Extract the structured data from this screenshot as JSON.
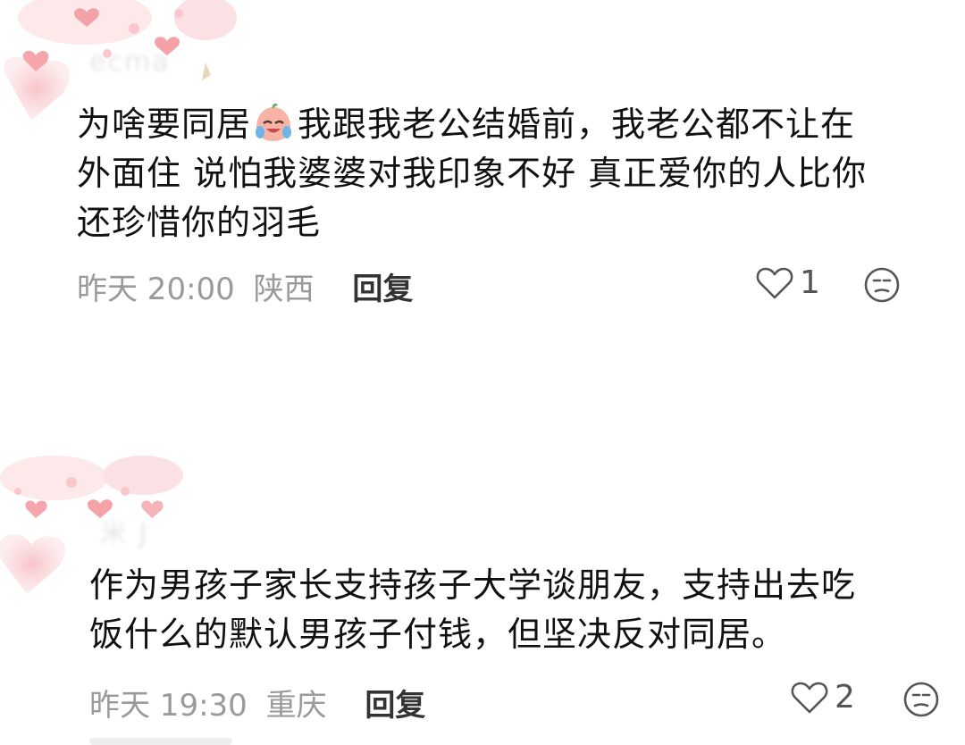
{
  "comments": [
    {
      "username": "ecma",
      "text_lines": [
        "为啥要同居",
        "我跟我老公结婚前，我老公都不让在",
        "外面住 说怕我婆婆对我印象不好 真正爱你的人比你",
        "还珍惜你的羽毛"
      ],
      "emoji": "crying-laughing-peach-emoji",
      "time": "昨天 20:00",
      "location": "陕西",
      "reply_label": "回复",
      "like_count": "1"
    },
    {
      "username": "米 J",
      "text_lines": [
        "作为男孩子家长支持孩子大学谈朋友，支持出去吃",
        "饭什么的默认男孩子付钱，但坚决反对同居。"
      ],
      "time": "昨天 19:30",
      "location": "重庆",
      "reply_label": "回复",
      "like_count": "2"
    }
  ],
  "icons": {
    "like": "heart-outline-icon",
    "dislike": "meh-face-icon",
    "avatar": "pink-hearts-avatar-frame"
  },
  "colors": {
    "text": "#111111",
    "meta": "#9a9a9a",
    "reply": "#333333",
    "hearts": "#f6a5ac"
  }
}
